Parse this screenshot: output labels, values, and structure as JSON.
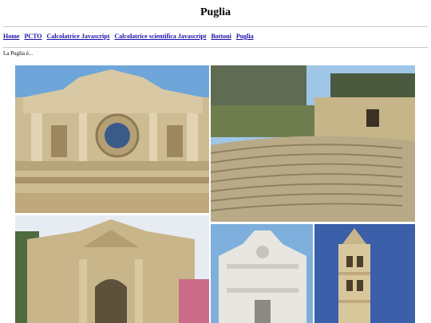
{
  "page": {
    "title": "Puglia",
    "intro": "La Puglia è..."
  },
  "nav": {
    "links": [
      "Home",
      "PCTO",
      "Calcolatrice Javascript",
      "Calcolatrice scientifica Javascript",
      "Bottoni",
      "Puglia"
    ]
  },
  "photos": [
    {
      "subject": "baroque church facade with rose window"
    },
    {
      "subject": "ancient roman amphitheatre with stone steps"
    },
    {
      "subject": "baroque stone city gate"
    },
    {
      "subject": "white baroque church facade"
    },
    {
      "subject": "stone bell tower"
    }
  ],
  "colors": {
    "link": "#1a0dab",
    "sky": "#6fa6da",
    "stone": "#c9b58a"
  }
}
